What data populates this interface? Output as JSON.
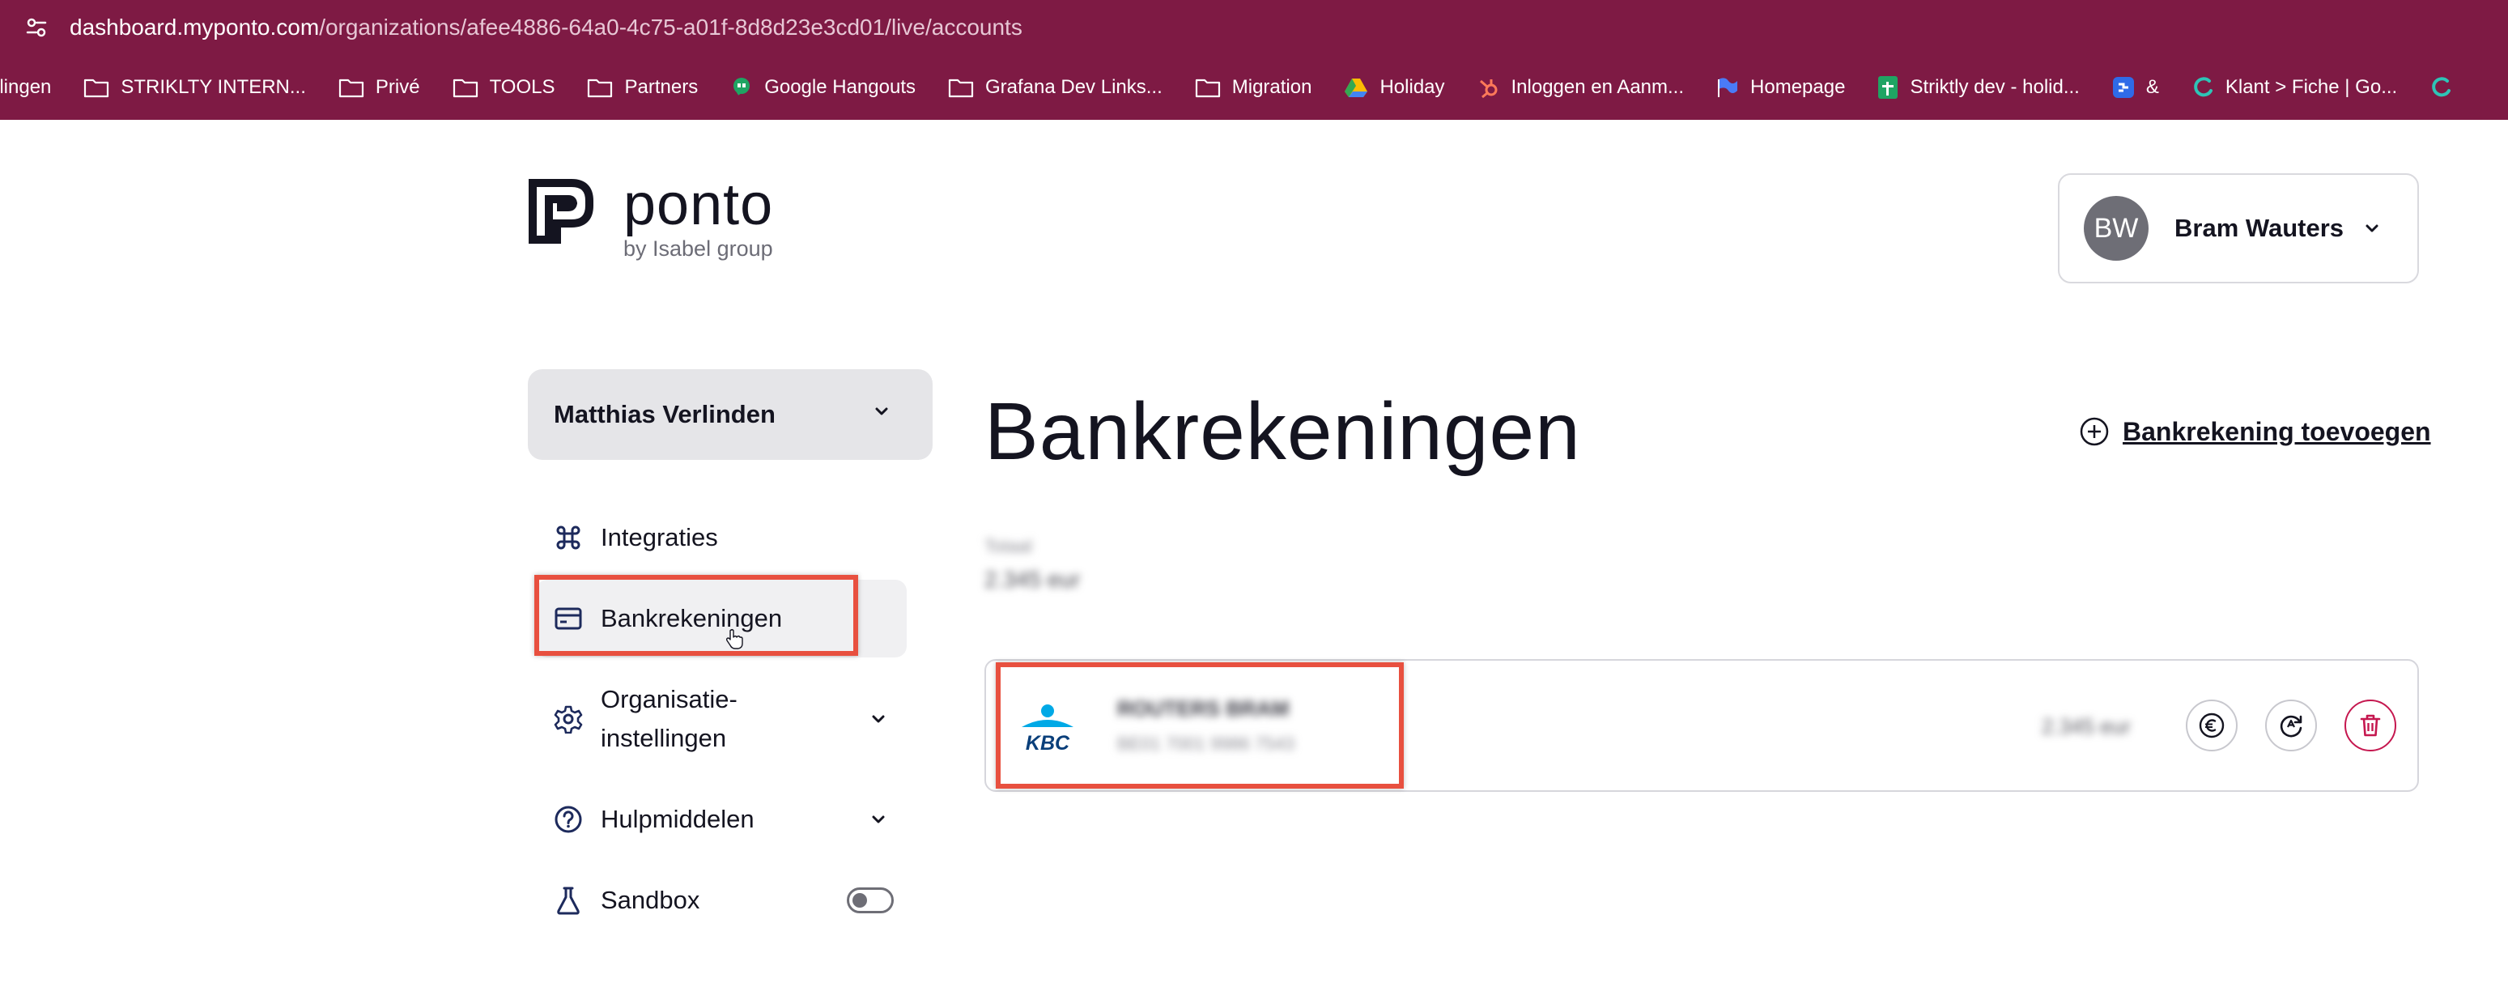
{
  "browser": {
    "url_host": "dashboard.myponto.com",
    "url_path": "/organizations/afee4886-64a0-4c75-a01f-8d8d23e3cd01/live/accounts",
    "bookmarks": [
      {
        "label": "llingen",
        "icon": "folder-icon"
      },
      {
        "label": "STRIKLTY INTERN...",
        "icon": "folder-icon"
      },
      {
        "label": "Privé",
        "icon": "folder-icon"
      },
      {
        "label": "TOOLS",
        "icon": "folder-icon"
      },
      {
        "label": "Partners",
        "icon": "folder-icon"
      },
      {
        "label": "Google Hangouts",
        "icon": "hangouts-icon"
      },
      {
        "label": "Grafana Dev Links...",
        "icon": "folder-icon"
      },
      {
        "label": "Migration",
        "icon": "folder-icon"
      },
      {
        "label": "Holiday",
        "icon": "drive-icon"
      },
      {
        "label": "Inloggen en Aanm...",
        "icon": "hubspot-icon"
      },
      {
        "label": "Homepage",
        "icon": "flag-icon"
      },
      {
        "label": "Striktly dev - holid...",
        "icon": "sheets-icon"
      },
      {
        "label": "&",
        "icon": "app-icon"
      },
      {
        "label": "Klant > Fiche | Go...",
        "icon": "swirl-icon"
      }
    ]
  },
  "brand": {
    "name": "ponto",
    "subtitle": "by Isabel group"
  },
  "user": {
    "initials": "BW",
    "name": "Bram Wauters"
  },
  "sidebar": {
    "organization": "Matthias Verlinden",
    "items": [
      {
        "label": "Integraties",
        "icon": "command-icon"
      },
      {
        "label": "Bankrekeningen",
        "icon": "card-icon"
      },
      {
        "label": "Organisatie-",
        "label2": "instellingen",
        "icon": "gear-icon"
      },
      {
        "label": "Hulpmiddelen",
        "icon": "help-icon"
      },
      {
        "label": "Sandbox",
        "icon": "flask-icon"
      }
    ]
  },
  "main": {
    "title": "Bankrekeningen",
    "add_account_label": "Bankrekening toevoegen",
    "summary_label": "Totaal",
    "summary_amount": "2.345 eur",
    "accounts": [
      {
        "bank": "KBC",
        "name": "ROUTERS BRAM",
        "iban": "BE01 7001 9986 7543",
        "balance": "2.345 eur"
      }
    ]
  },
  "colors": {
    "browser_bar": "#7e1a44",
    "annotation": "#e8503f",
    "danger": "#c5174f",
    "kbc_blue": "#0a3f7a",
    "kbc_light": "#00a9e6"
  }
}
